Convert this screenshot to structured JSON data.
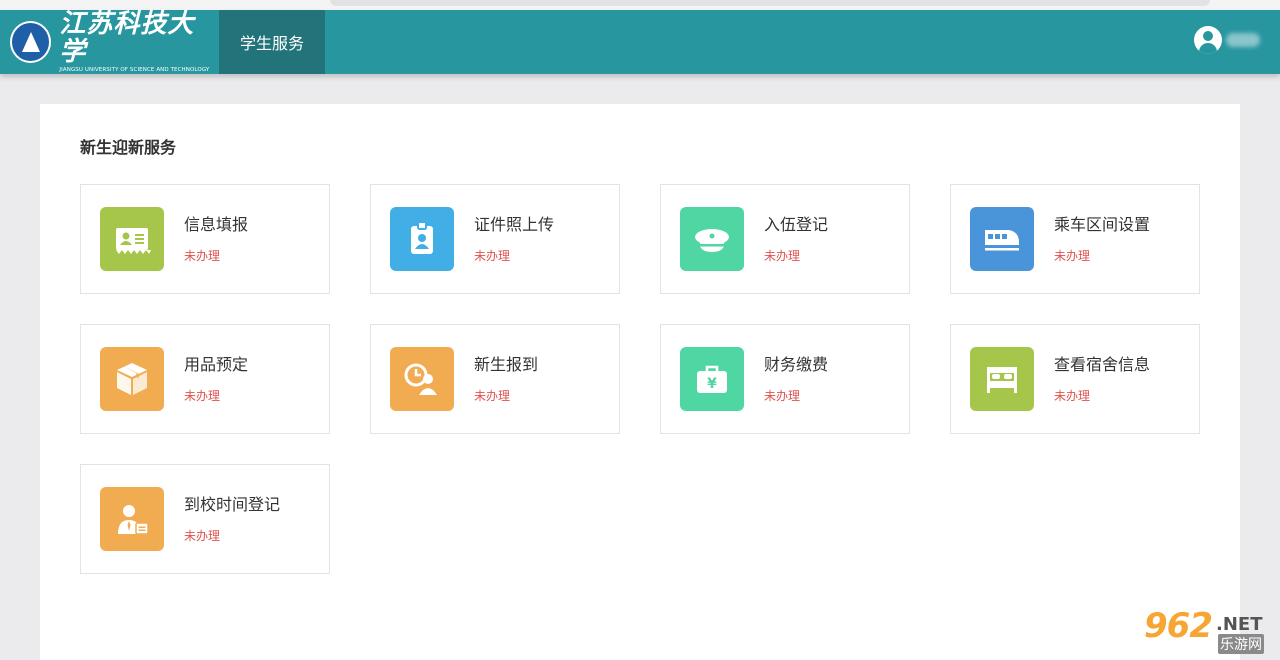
{
  "header": {
    "logo_cn": "江苏科技大学",
    "logo_en": "JIANGSU UNIVERSITY OF SCIENCE AND TECHNOLOGY",
    "nav_tab": "学生服务",
    "colors": {
      "bar": "#28969f",
      "active_tab": "#23737a"
    }
  },
  "main": {
    "section_title": "新生迎新服务",
    "cards": [
      {
        "title": "信息填报",
        "status": "未办理",
        "icon": "id-card-icon",
        "color": "#a5c64a"
      },
      {
        "title": "证件照上传",
        "status": "未办理",
        "icon": "badge-photo-icon",
        "color": "#41aee6"
      },
      {
        "title": "入伍登记",
        "status": "未办理",
        "icon": "military-cap-icon",
        "color": "#4fd6a2"
      },
      {
        "title": "乘车区间设置",
        "status": "未办理",
        "icon": "train-icon",
        "color": "#4a95d9"
      },
      {
        "title": "用品预定",
        "status": "未办理",
        "icon": "package-box-icon",
        "color": "#f1ac52"
      },
      {
        "title": "新生报到",
        "status": "未办理",
        "icon": "clock-person-icon",
        "color": "#f1ac52"
      },
      {
        "title": "财务缴费",
        "status": "未办理",
        "icon": "yen-bag-icon",
        "color": "#4fd6a2"
      },
      {
        "title": "查看宿舍信息",
        "status": "未办理",
        "icon": "bed-icon",
        "color": "#a5c64a"
      },
      {
        "title": "到校时间登记",
        "status": "未办理",
        "icon": "person-form-icon",
        "color": "#f1ac52"
      }
    ]
  },
  "watermark": {
    "number": "962",
    "suffix": ".NET",
    "cn": "乐游网"
  }
}
